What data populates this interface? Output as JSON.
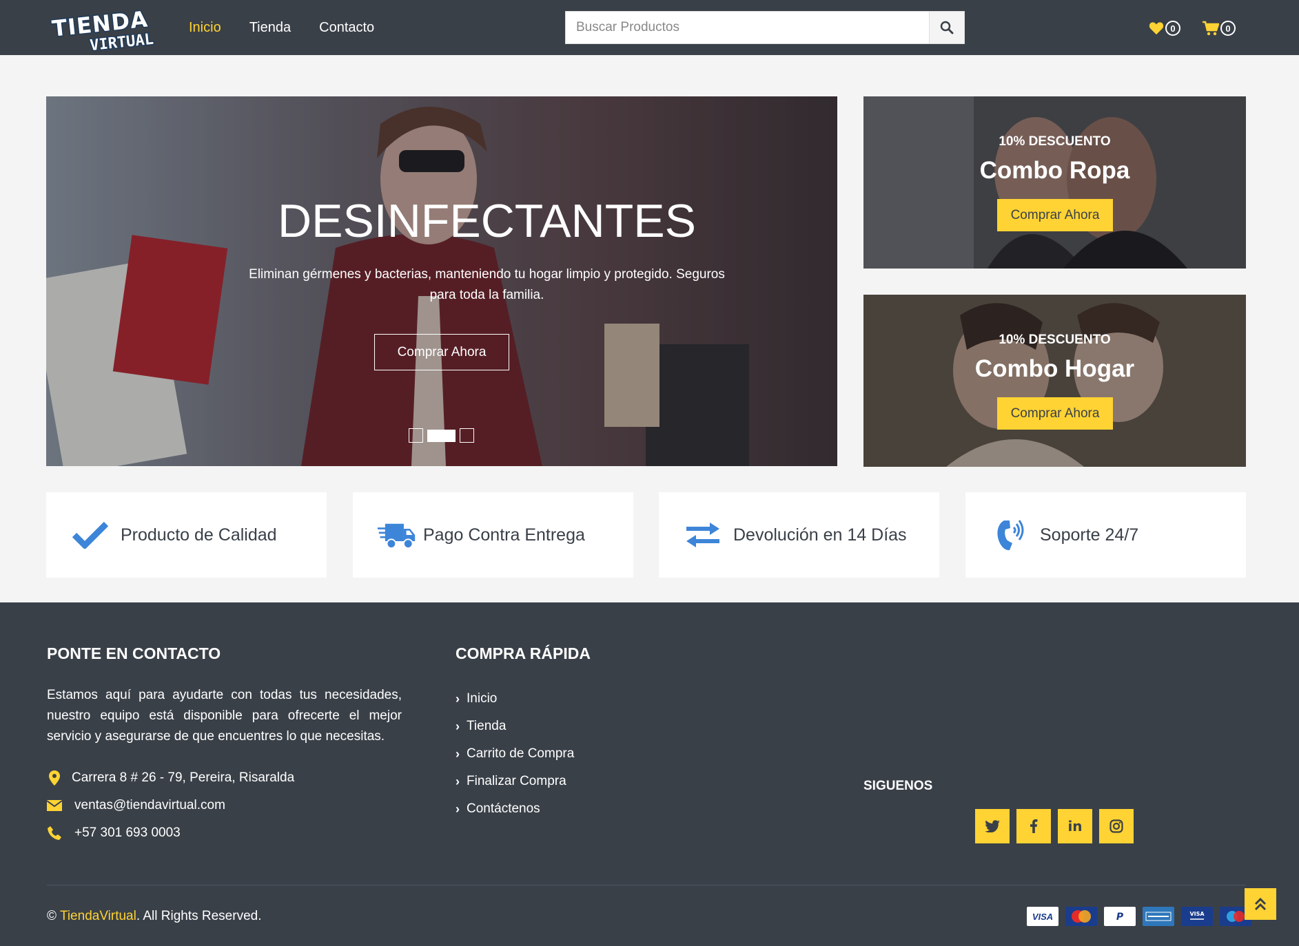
{
  "header": {
    "logo_line1": "TIENDA",
    "logo_line2": "VIRTUAL",
    "nav": [
      {
        "label": "Inicio",
        "active": true
      },
      {
        "label": "Tienda",
        "active": false
      },
      {
        "label": "Contacto",
        "active": false
      }
    ],
    "search_placeholder": "Buscar Productos",
    "wishlist_count": "0",
    "cart_count": "0"
  },
  "hero": {
    "title": "DESINFECTANTES",
    "description": "Eliminan gérmenes y bacterias, manteniendo tu hogar limpio y protegido. Seguros para toda la familia.",
    "cta": "Comprar Ahora",
    "slides_total": 3,
    "active_slide": 2
  },
  "offers": [
    {
      "discount": "10% DESCUENTO",
      "name": "Combo Ropa",
      "cta": "Comprar Ahora"
    },
    {
      "discount": "10% DESCUENTO",
      "name": "Combo Hogar",
      "cta": "Comprar Ahora"
    }
  ],
  "features": [
    {
      "icon": "check-icon",
      "label": "Producto de Calidad"
    },
    {
      "icon": "shipping-truck-icon",
      "label": "Pago Contra Entrega"
    },
    {
      "icon": "exchange-arrows-icon",
      "label": "Devolución en 14 Días"
    },
    {
      "icon": "phone-volume-icon",
      "label": "Soporte 24/7"
    }
  ],
  "footer": {
    "contact_heading": "PONTE EN CONTACTO",
    "contact_text": "Estamos aquí para ayudarte con todas tus necesidades, nuestro equipo está disponible para ofrecerte el mejor servicio y asegurarse de que encuentres lo que necesitas.",
    "address": "Carrera 8 # 26 - 79, Pereira, Risaralda",
    "email": "ventas@tiendavirtual.com",
    "phone": "+57 301 693 0003",
    "quick_heading": "COMPRA RÁPIDA",
    "quick_links": [
      "Inicio",
      "Tienda",
      "Carrito de Compra",
      "Finalizar Compra",
      "Contáctenos"
    ],
    "follow_heading": "SIGUENOS",
    "social": [
      "twitter-icon",
      "facebook-icon",
      "linkedin-icon",
      "instagram-icon"
    ],
    "copyright_prefix": "©",
    "copyright_brand": "TiendaVirtual",
    "copyright_suffix": ". All Rights Reserved.",
    "payment_cards": [
      "VISA",
      "MasterCard",
      "PayPal",
      "AMERICAN EXPRESS",
      "VISA Electron",
      "Maestro"
    ]
  },
  "colors": {
    "dark": "#3a4048",
    "accent": "#ffd333",
    "blue": "#3d85d8",
    "bg": "#f4f4f4"
  }
}
